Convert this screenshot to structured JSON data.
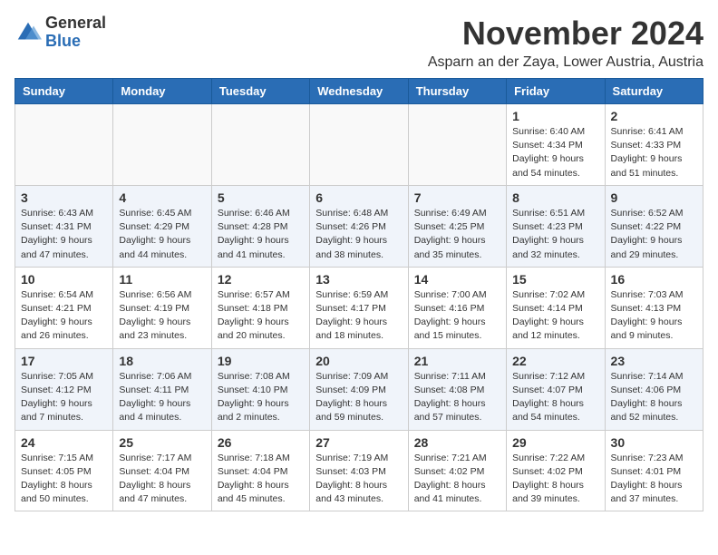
{
  "logo": {
    "general": "General",
    "blue": "Blue"
  },
  "header": {
    "month_title": "November 2024",
    "subtitle": "Asparn an der Zaya, Lower Austria, Austria"
  },
  "weekdays": [
    "Sunday",
    "Monday",
    "Tuesday",
    "Wednesday",
    "Thursday",
    "Friday",
    "Saturday"
  ],
  "weeks": [
    [
      {
        "day": "",
        "info": ""
      },
      {
        "day": "",
        "info": ""
      },
      {
        "day": "",
        "info": ""
      },
      {
        "day": "",
        "info": ""
      },
      {
        "day": "",
        "info": ""
      },
      {
        "day": "1",
        "info": "Sunrise: 6:40 AM\nSunset: 4:34 PM\nDaylight: 9 hours\nand 54 minutes."
      },
      {
        "day": "2",
        "info": "Sunrise: 6:41 AM\nSunset: 4:33 PM\nDaylight: 9 hours\nand 51 minutes."
      }
    ],
    [
      {
        "day": "3",
        "info": "Sunrise: 6:43 AM\nSunset: 4:31 PM\nDaylight: 9 hours\nand 47 minutes."
      },
      {
        "day": "4",
        "info": "Sunrise: 6:45 AM\nSunset: 4:29 PM\nDaylight: 9 hours\nand 44 minutes."
      },
      {
        "day": "5",
        "info": "Sunrise: 6:46 AM\nSunset: 4:28 PM\nDaylight: 9 hours\nand 41 minutes."
      },
      {
        "day": "6",
        "info": "Sunrise: 6:48 AM\nSunset: 4:26 PM\nDaylight: 9 hours\nand 38 minutes."
      },
      {
        "day": "7",
        "info": "Sunrise: 6:49 AM\nSunset: 4:25 PM\nDaylight: 9 hours\nand 35 minutes."
      },
      {
        "day": "8",
        "info": "Sunrise: 6:51 AM\nSunset: 4:23 PM\nDaylight: 9 hours\nand 32 minutes."
      },
      {
        "day": "9",
        "info": "Sunrise: 6:52 AM\nSunset: 4:22 PM\nDaylight: 9 hours\nand 29 minutes."
      }
    ],
    [
      {
        "day": "10",
        "info": "Sunrise: 6:54 AM\nSunset: 4:21 PM\nDaylight: 9 hours\nand 26 minutes."
      },
      {
        "day": "11",
        "info": "Sunrise: 6:56 AM\nSunset: 4:19 PM\nDaylight: 9 hours\nand 23 minutes."
      },
      {
        "day": "12",
        "info": "Sunrise: 6:57 AM\nSunset: 4:18 PM\nDaylight: 9 hours\nand 20 minutes."
      },
      {
        "day": "13",
        "info": "Sunrise: 6:59 AM\nSunset: 4:17 PM\nDaylight: 9 hours\nand 18 minutes."
      },
      {
        "day": "14",
        "info": "Sunrise: 7:00 AM\nSunset: 4:16 PM\nDaylight: 9 hours\nand 15 minutes."
      },
      {
        "day": "15",
        "info": "Sunrise: 7:02 AM\nSunset: 4:14 PM\nDaylight: 9 hours\nand 12 minutes."
      },
      {
        "day": "16",
        "info": "Sunrise: 7:03 AM\nSunset: 4:13 PM\nDaylight: 9 hours\nand 9 minutes."
      }
    ],
    [
      {
        "day": "17",
        "info": "Sunrise: 7:05 AM\nSunset: 4:12 PM\nDaylight: 9 hours\nand 7 minutes."
      },
      {
        "day": "18",
        "info": "Sunrise: 7:06 AM\nSunset: 4:11 PM\nDaylight: 9 hours\nand 4 minutes."
      },
      {
        "day": "19",
        "info": "Sunrise: 7:08 AM\nSunset: 4:10 PM\nDaylight: 9 hours\nand 2 minutes."
      },
      {
        "day": "20",
        "info": "Sunrise: 7:09 AM\nSunset: 4:09 PM\nDaylight: 8 hours\nand 59 minutes."
      },
      {
        "day": "21",
        "info": "Sunrise: 7:11 AM\nSunset: 4:08 PM\nDaylight: 8 hours\nand 57 minutes."
      },
      {
        "day": "22",
        "info": "Sunrise: 7:12 AM\nSunset: 4:07 PM\nDaylight: 8 hours\nand 54 minutes."
      },
      {
        "day": "23",
        "info": "Sunrise: 7:14 AM\nSunset: 4:06 PM\nDaylight: 8 hours\nand 52 minutes."
      }
    ],
    [
      {
        "day": "24",
        "info": "Sunrise: 7:15 AM\nSunset: 4:05 PM\nDaylight: 8 hours\nand 50 minutes."
      },
      {
        "day": "25",
        "info": "Sunrise: 7:17 AM\nSunset: 4:04 PM\nDaylight: 8 hours\nand 47 minutes."
      },
      {
        "day": "26",
        "info": "Sunrise: 7:18 AM\nSunset: 4:04 PM\nDaylight: 8 hours\nand 45 minutes."
      },
      {
        "day": "27",
        "info": "Sunrise: 7:19 AM\nSunset: 4:03 PM\nDaylight: 8 hours\nand 43 minutes."
      },
      {
        "day": "28",
        "info": "Sunrise: 7:21 AM\nSunset: 4:02 PM\nDaylight: 8 hours\nand 41 minutes."
      },
      {
        "day": "29",
        "info": "Sunrise: 7:22 AM\nSunset: 4:02 PM\nDaylight: 8 hours\nand 39 minutes."
      },
      {
        "day": "30",
        "info": "Sunrise: 7:23 AM\nSunset: 4:01 PM\nDaylight: 8 hours\nand 37 minutes."
      }
    ]
  ]
}
